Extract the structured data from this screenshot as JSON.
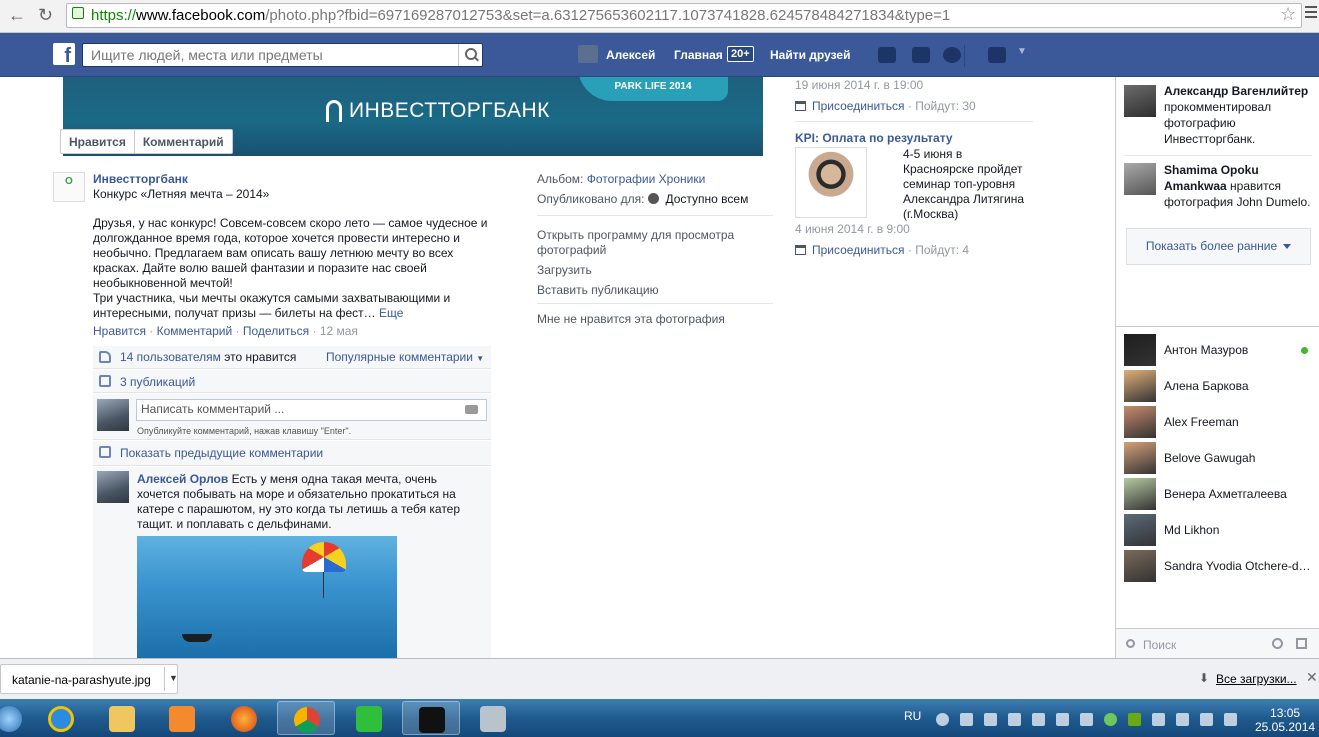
{
  "browser": {
    "url_scheme": "https://",
    "url_host": "www.facebook.com",
    "url_rest": "/photo.php?fbid=697169287012753&set=a.631275653602117.1073741828.624578484271834&type=1"
  },
  "fb": {
    "search_placeholder": "Ищите людей, места или предметы",
    "user_name": "Алексей",
    "home_label": "Главная",
    "home_badge": "20+",
    "find_friends_label": "Найти друзей"
  },
  "photo": {
    "banner_ribbon": "PARK LIFE 2014",
    "banner_bank": "ИНВЕСТТОРГБАНК",
    "like_label": "Нравится",
    "comment_label": "Комментарий"
  },
  "post": {
    "author": "Инвестторгбанк",
    "subtitle": "Конкурс «Летняя мечта – 2014»",
    "body_1": "Друзья, у нас конкурс! Совсем-совсем скоро лето — самое чудесное и долгожданное время года, которое хочется провести интересно и необычно. Предлагаем вам описать вашу летнюю мечту во всех красках. Дайте волю вашей фантазии и поразите нас своей необыкновенной мечтой!",
    "body_2": "Три участника, чьи мечты окажутся самыми захватывающими и интересными, получат призы — билеты на фест…",
    "more_link": "Еще",
    "action_like": "Нравится",
    "action_comment": "Комментарий",
    "action_share": "Поделиться",
    "date": "12 мая",
    "likes_link": "14 пользователям",
    "likes_rest": " это нравится",
    "popular_comments": "Популярные комментарии",
    "shares": "3 публикаций",
    "comment_placeholder": "Написать комментарий ...",
    "comment_hint": "Опубликуйте комментарий, нажав клавишу \"Enter\".",
    "show_previous": "Показать предыдущие комментарии",
    "comment_author": "Алексей Орлов",
    "comment_text": " Есть у меня одна такая мечта, очень хочется побывать на море и обязательно прокатиться на катере с парашютом, ну это когда ты летишь а тебя катер тащит. и поплавать с дельфинами."
  },
  "photo_info": {
    "album_label": "Альбом:",
    "album_value": "Фотографии Хроники",
    "published_label": "Опубликовано для:",
    "published_value": "Доступно всем",
    "open_viewer": "Открыть программу для просмотра фотографий",
    "download": "Загрузить",
    "embed": "Вставить публикацию",
    "dislike": "Мне не нравится эта фотография"
  },
  "events": {
    "e1_date": "19 июня 2014 г. в 19:00",
    "e1_join": "Присоединиться",
    "e1_going": "· Пойдут: 30",
    "e2_title": "KPI: Оплата по результату",
    "e2_desc": "4-5 июня в Красноярске пройдет семинар топ-уровня Александра Литягина (г.Москва)",
    "e2_date": "4 июня 2014 г. в 9:00",
    "e2_join": "Присоединиться",
    "e2_going": "· Пойдут: 4"
  },
  "ticker": {
    "t1_name": "Александр Вагенлийтер",
    "t1_text": " прокомментировал фотографию Инвестторгбанк.",
    "t2_name": "Shamima Opoku Amankwaa",
    "t2_text": " нравится фотография John Dumelo.",
    "show_more": "Показать более ранние"
  },
  "chat": {
    "contacts": [
      "Антон Мазуров",
      "Алена Баркова",
      "Alex Freeman",
      "Belove Gawugah",
      "Венера Ахметгалеева",
      "Md Likhon",
      "Sandra Yvodia Otchere-d…"
    ],
    "search_placeholder": "Поиск"
  },
  "downloads": {
    "file": "katanie-na-parashyute.jpg",
    "all": "Все загрузки..."
  },
  "taskbar": {
    "lang": "RU",
    "time": "13:05",
    "date": "25.05.2014"
  },
  "colors": {
    "fb_blue": "#3b5998",
    "link": "#3b5998",
    "online": "#42b72a"
  }
}
